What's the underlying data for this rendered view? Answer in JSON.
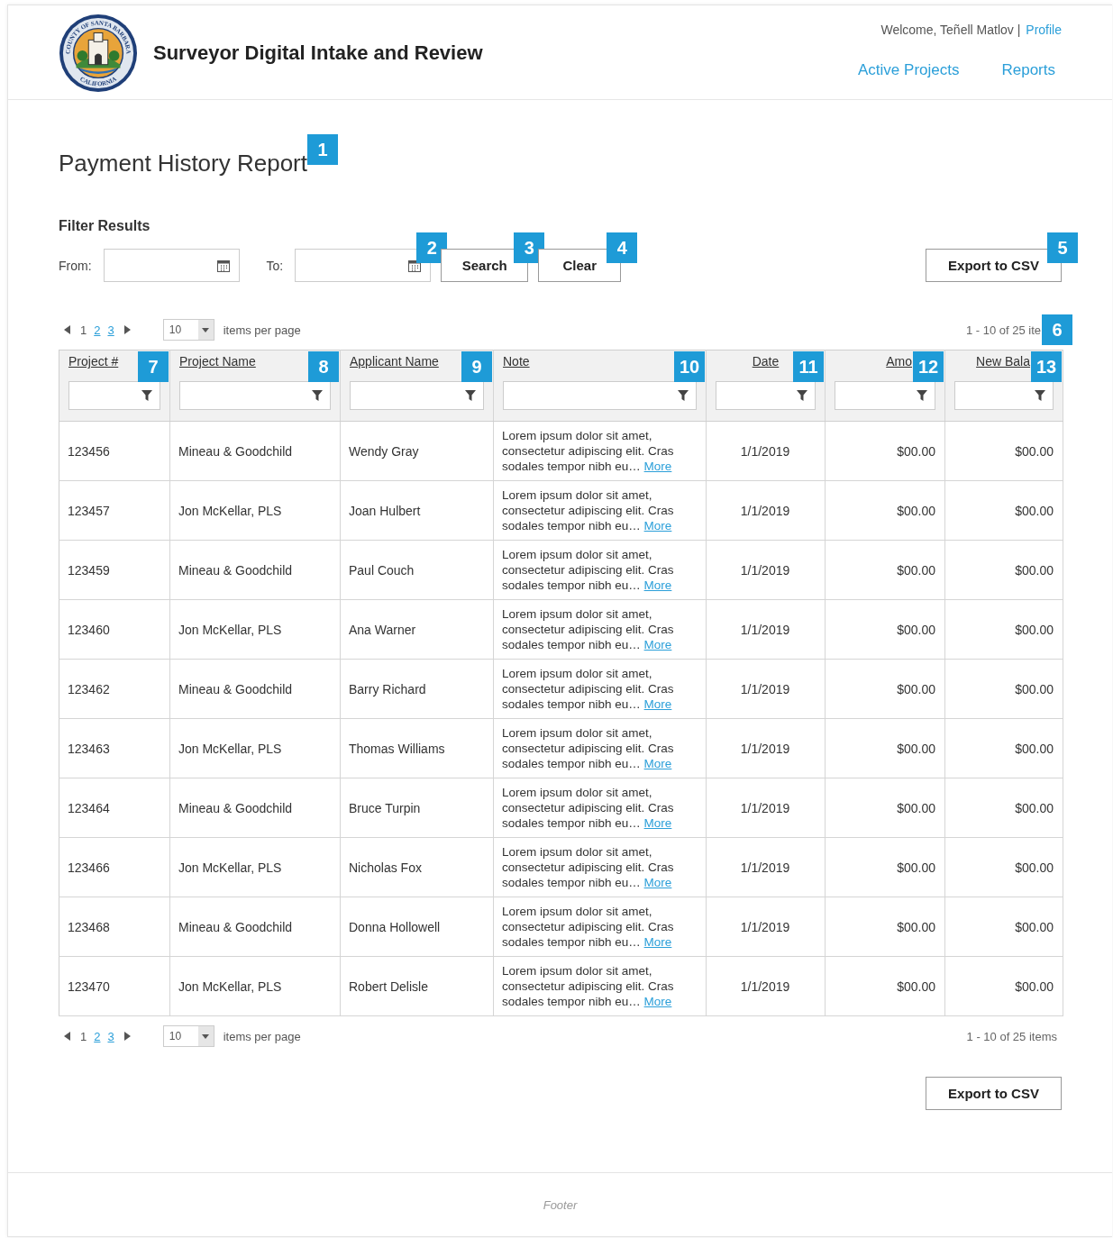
{
  "header": {
    "seal_top": "COUNTY OF SANTA BARBARA",
    "seal_bottom": "CALIFORNIA",
    "title": "Surveyor Digital Intake and Review",
    "welcome": "Welcome, Teñell Matlov |",
    "profile": "Profile",
    "nav": [
      {
        "label": "Active Projects"
      },
      {
        "label": "Reports"
      }
    ]
  },
  "page_title": {
    "text": "Payment History Report",
    "callout": "1"
  },
  "filter": {
    "heading": "Filter Results",
    "from_label": "From:",
    "to_label": "To:",
    "to_callout": "2",
    "buttons": [
      {
        "label": "Search",
        "callout": "3"
      },
      {
        "label": "Clear",
        "callout": "4"
      }
    ],
    "export": {
      "label": "Export to CSV",
      "callout": "5"
    }
  },
  "pager_top": {
    "pages": [
      {
        "label": "1",
        "selected": true
      },
      {
        "label": "2",
        "selected": false
      },
      {
        "label": "3",
        "selected": false
      }
    ],
    "per_page": "10",
    "per_page_label": "items per page",
    "summary": "1 - 10 of 25 ite",
    "callout": "6"
  },
  "table": {
    "columns": [
      {
        "label": "Project #",
        "kind": "text",
        "callout": "7"
      },
      {
        "label": "Project Name",
        "kind": "text",
        "callout": "8"
      },
      {
        "label": "Applicant Name",
        "kind": "text",
        "callout": "9"
      },
      {
        "label": "Note",
        "kind": "note",
        "callout": "10"
      },
      {
        "label": "Date",
        "kind": "date",
        "callout": "11"
      },
      {
        "label": "Amo",
        "kind": "money",
        "callout": "12"
      },
      {
        "label": "New Bala",
        "kind": "money",
        "callout": "13"
      }
    ],
    "rows": [
      {
        "cells": [
          "123456",
          "Mineau & Goodchild",
          "Wendy Gray",
          "Lorem ipsum dolor sit amet, consectetur adipiscing elit. Cras sodales tempor nibh eu…",
          "1/1/2019",
          "$00.00",
          "$00.00"
        ],
        "link": "More"
      },
      {
        "cells": [
          "123457",
          "Jon McKellar, PLS",
          "Joan Hulbert",
          "Lorem ipsum dolor sit amet, consectetur adipiscing elit. Cras sodales tempor nibh eu…",
          "1/1/2019",
          "$00.00",
          "$00.00"
        ],
        "link": "More"
      },
      {
        "cells": [
          "123459",
          "Mineau & Goodchild",
          "Paul Couch",
          "Lorem ipsum dolor sit amet, consectetur adipiscing elit. Cras sodales tempor nibh eu…",
          "1/1/2019",
          "$00.00",
          "$00.00"
        ],
        "link": "More"
      },
      {
        "cells": [
          "123460",
          "Jon McKellar, PLS",
          "Ana Warner",
          "Lorem ipsum dolor sit amet, consectetur adipiscing elit. Cras sodales tempor nibh eu…",
          "1/1/2019",
          "$00.00",
          "$00.00"
        ],
        "link": "More"
      },
      {
        "cells": [
          "123462",
          "Mineau & Goodchild",
          "Barry Richard",
          "Lorem ipsum dolor sit amet, consectetur adipiscing elit. Cras sodales tempor nibh eu…",
          "1/1/2019",
          "$00.00",
          "$00.00"
        ],
        "link": "More"
      },
      {
        "cells": [
          "123463",
          "Jon McKellar, PLS",
          "Thomas Williams",
          "Lorem ipsum dolor sit amet, consectetur adipiscing elit. Cras sodales tempor nibh eu…",
          "1/1/2019",
          "$00.00",
          "$00.00"
        ],
        "link": "More"
      },
      {
        "cells": [
          "123464",
          "Mineau & Goodchild",
          "Bruce Turpin",
          "Lorem ipsum dolor sit amet, consectetur adipiscing elit. Cras sodales tempor nibh eu…",
          "1/1/2019",
          "$00.00",
          "$00.00"
        ],
        "link": "More"
      },
      {
        "cells": [
          "123466",
          "Jon McKellar, PLS",
          "Nicholas Fox",
          "Lorem ipsum dolor sit amet, consectetur adipiscing elit. Cras sodales tempor nibh eu…",
          "1/1/2019",
          "$00.00",
          "$00.00"
        ],
        "link": "More"
      },
      {
        "cells": [
          "123468",
          "Mineau & Goodchild",
          "Donna Hollowell",
          "Lorem ipsum dolor sit amet, consectetur adipiscing elit. Cras sodales tempor nibh eu…",
          "1/1/2019",
          "$00.00",
          "$00.00"
        ],
        "link": "More"
      },
      {
        "cells": [
          "123470",
          "Jon McKellar, PLS",
          "Robert Delisle",
          "Lorem ipsum dolor sit amet, consectetur adipiscing elit. Cras sodales tempor nibh eu…",
          "1/1/2019",
          "$00.00",
          "$00.00"
        ],
        "link": "More"
      }
    ]
  },
  "pager_bottom": {
    "pages": [
      {
        "label": "1",
        "selected": true
      },
      {
        "label": "2",
        "selected": false
      },
      {
        "label": "3",
        "selected": false
      }
    ],
    "per_page": "10",
    "per_page_label": "items per page",
    "summary": "1 - 10 of 25 items"
  },
  "export_bottom": {
    "label": "Export to CSV"
  },
  "footer": "Footer"
}
